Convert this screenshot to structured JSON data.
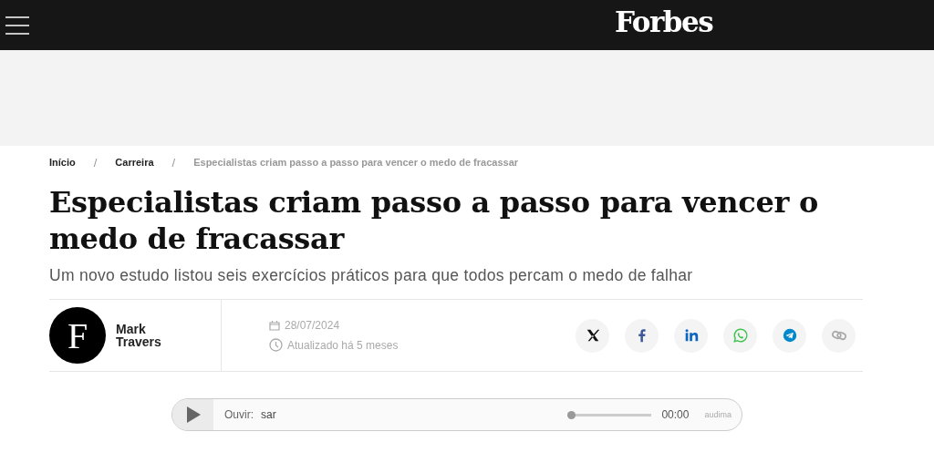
{
  "header": {
    "logo": "Forbes"
  },
  "breadcrumb": [
    {
      "label": "Início",
      "selected": false
    },
    {
      "separator": "/",
      "label": "Carreira",
      "selected": false
    },
    {
      "separator": "/",
      "label": "Especialistas criam passo a passo para vencer o medo de fracassar",
      "selected": true
    }
  ],
  "article": {
    "title": "Especialistas criam passo a passo para vencer o medo de fracassar",
    "subtitle": "Um novo estudo listou seis exercícios práticos para que todos percam o medo de falhar"
  },
  "author": {
    "avatar_letter": "F",
    "name": "Mark Travers",
    "date": "28/07/2024",
    "updated": "Atualizado há 5 meses"
  },
  "share": [
    {
      "kind": "x"
    },
    {
      "kind": "facebook"
    },
    {
      "kind": "linkedin"
    },
    {
      "kind": "whatsapp"
    },
    {
      "kind": "telegram"
    },
    {
      "kind": "link"
    }
  ],
  "player": {
    "label": "Ouvir:",
    "scrolling_title": "sar",
    "level": 0,
    "time": "00:00",
    "brand": "audima"
  }
}
